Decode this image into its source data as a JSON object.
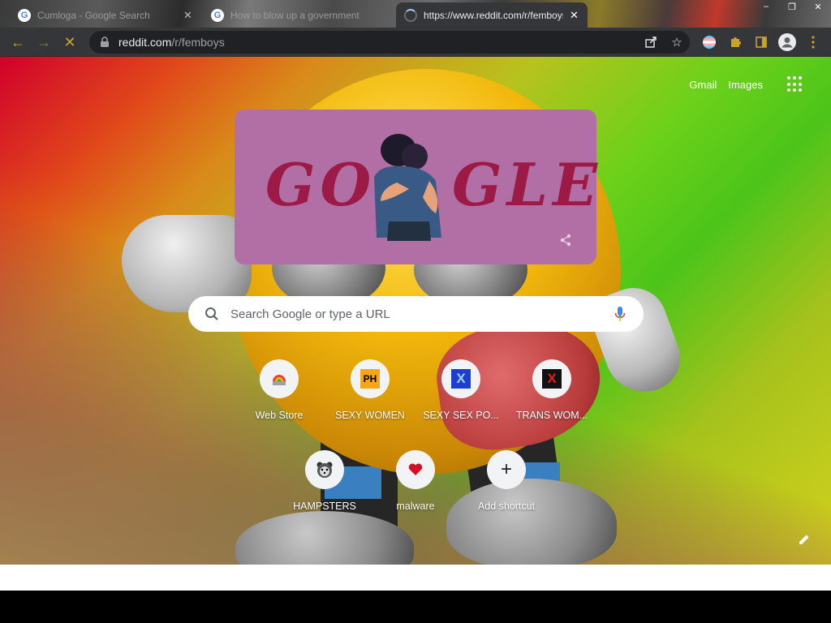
{
  "tabs": [
    {
      "title": "Cumloga - Google Search",
      "favicon": "google-icon"
    },
    {
      "title": "How to blow up a government",
      "favicon": "google-icon"
    },
    {
      "title": "https://www.reddit.com/r/femboys",
      "favicon": "loading-spinner-icon",
      "active": true
    }
  ],
  "window_controls": {
    "minimize": "–",
    "restore": "❐",
    "close": "✕"
  },
  "toolbar": {
    "back": "←",
    "forward": "→",
    "stop": "✕",
    "url_host": "reddit.com",
    "url_path": "/r/femboys"
  },
  "ntp": {
    "gmail": "Gmail",
    "images": "Images",
    "doodle_text_left": "GO",
    "doodle_text_right": "GLE",
    "search_placeholder": "Search Google or type a URL",
    "shortcuts": [
      {
        "label": "Web Store",
        "icon": "chrome-web-store-icon"
      },
      {
        "label": "SEXY WOMEN",
        "icon": "ph-icon",
        "badge": "PH"
      },
      {
        "label": "SEXY SEX PO...",
        "icon": "x-blue-icon",
        "badge": "X"
      },
      {
        "label": "TRANS WOM...",
        "icon": "x-red-icon",
        "badge": "X"
      },
      {
        "label": "HAMPSTERS",
        "icon": "hamster-icon"
      },
      {
        "label": "malware",
        "icon": "heart-icon"
      },
      {
        "label": "Add shortcut",
        "icon": "plus-icon",
        "badge": "+"
      }
    ]
  },
  "colors": {
    "accent_yellow": "#c9a227",
    "doodle_bg": "#b26fa6",
    "doodle_text": "#9b1a46",
    "toolbar_bg": "#35363a"
  }
}
